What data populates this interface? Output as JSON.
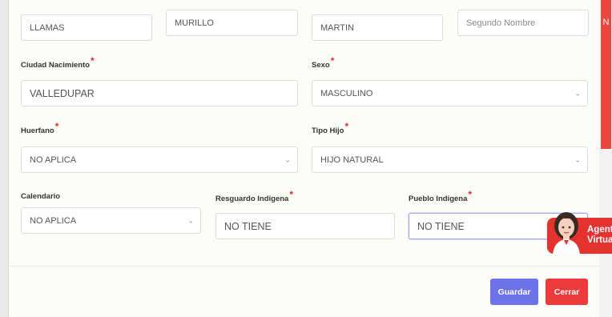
{
  "form": {
    "row1": {
      "apellido1": {
        "value": "LLAMAS"
      },
      "apellido2": {
        "value": "MURILLO"
      },
      "nombre1": {
        "value": "MARTIN"
      },
      "nombre2": {
        "placeholder": "Segundo Nombre"
      }
    },
    "ciudad_nacimiento": {
      "label": "Ciudad Nacimiento",
      "value": "VALLEDUPAR"
    },
    "sexo": {
      "label": "Sexo",
      "value": "MASCULINO"
    },
    "huerfano": {
      "label": "Huerfano",
      "value": "NO APLICA"
    },
    "tipo_hijo": {
      "label": "Tipo Hijo",
      "value": "HIJO NATURAL"
    },
    "calendario": {
      "label": "Calendario",
      "value": "NO APLICA"
    },
    "resguardo_indigena": {
      "label": "Resguardo Indigena",
      "value": "NO TIENE"
    },
    "pueblo_indigena": {
      "label": "Pueblo Indigena",
      "value": "NO TIENE"
    },
    "required_mark": "*"
  },
  "buttons": {
    "save": "Guardar",
    "close": "Cerrar"
  },
  "agent_widget": {
    "line1": "Agent",
    "line2": "Virtua"
  },
  "scrollbar_letter": "N",
  "colors": {
    "accent": "#6c72e8",
    "danger": "#ed3a3a",
    "required": "#e02b2b"
  }
}
